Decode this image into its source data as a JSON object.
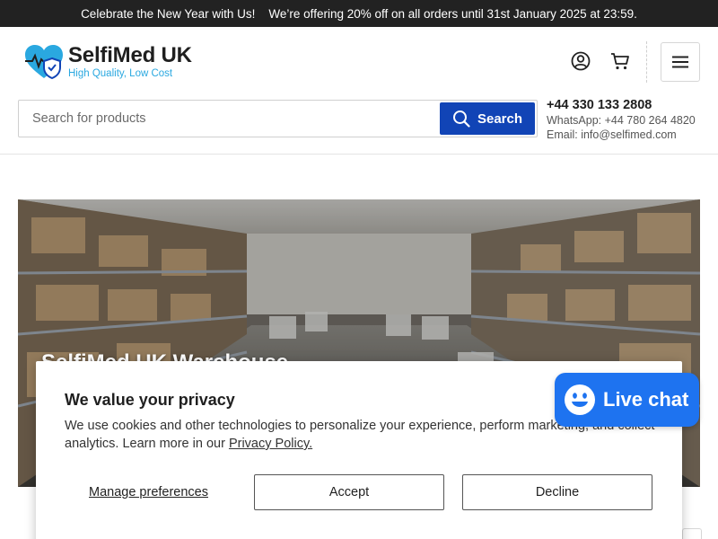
{
  "announcement": "Celebrate the New Year with Us!    We’re offering 20% off on all orders until 31st January 2025 at 23:59.",
  "brand": {
    "name": "SelfiMed UK",
    "tagline": "High Quality, Low Cost",
    "color_heart": "#2aa8e0",
    "color_shield": "#1144b6"
  },
  "header": {
    "icons": [
      "user-icon",
      "cart-icon",
      "menu-icon"
    ]
  },
  "search": {
    "placeholder": "Search for products",
    "button_label": "Search",
    "button_color": "#1144b6"
  },
  "contact": {
    "phone": "+44 330 133 2808",
    "whatsapp": "WhatsApp: +44 780 264 4820",
    "email": "Email: info@selfimed.com"
  },
  "hero": {
    "title": "SelfiMed UK Warehouse"
  },
  "cookie": {
    "title": "We value your privacy",
    "text": "We use cookies and other technologies to personalize your experience, perform marketing, and collect analytics. Learn more in our ",
    "policy_link": "Privacy Policy.",
    "manage_label": "Manage preferences",
    "accept_label": "Accept",
    "decline_label": "Decline"
  },
  "livechat": {
    "label": "Live chat",
    "color": "#1e73f0"
  }
}
